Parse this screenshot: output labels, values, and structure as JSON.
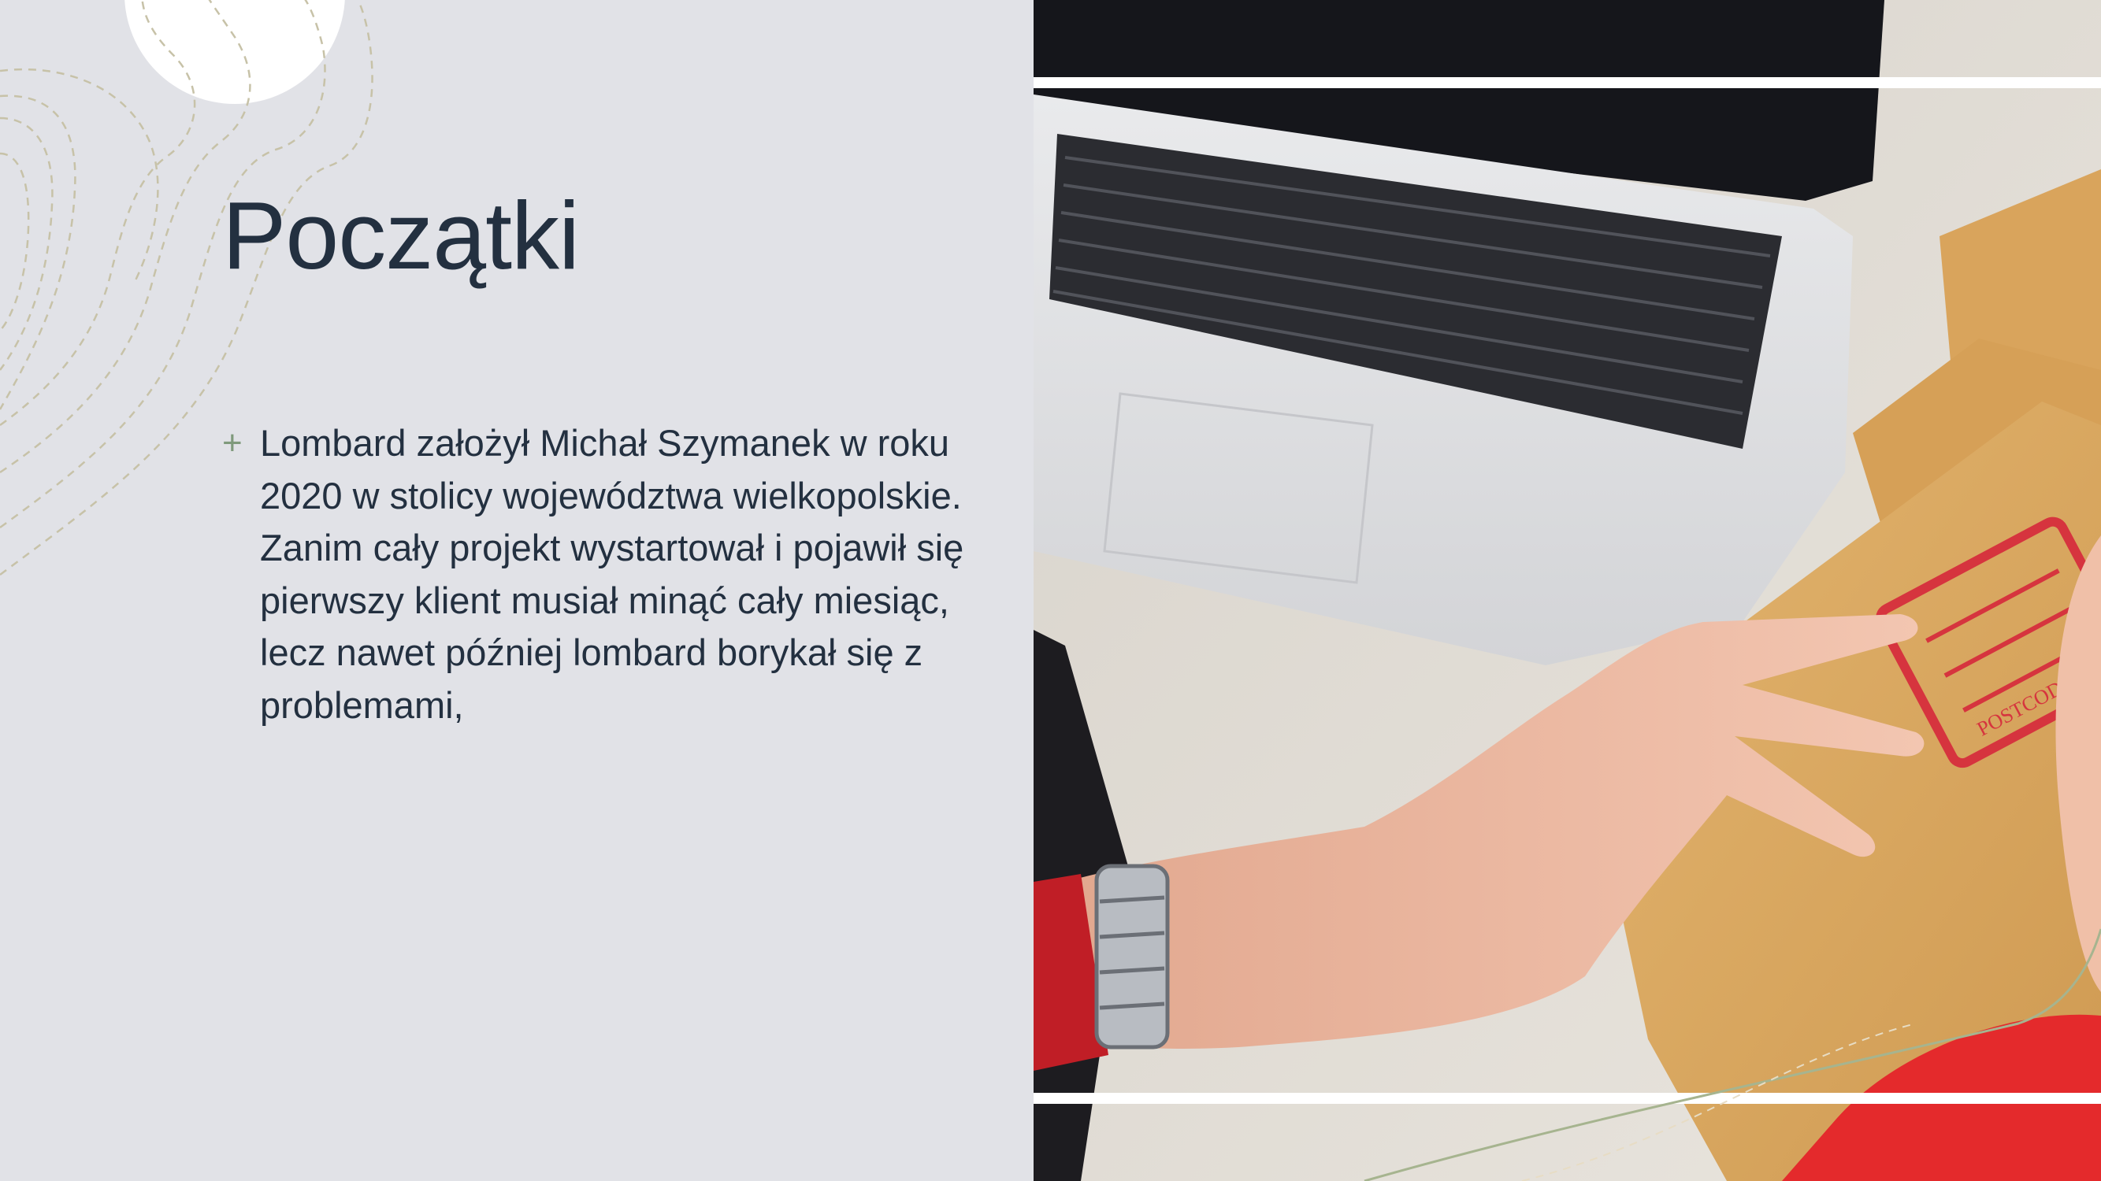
{
  "slide": {
    "title": "Początki",
    "bullets": [
      {
        "marker": "+",
        "text": "Lombard założył Michał Szymanek w roku 2020 w stolicy województwa wielkopolskie. Zanim cały projekt wystartował i pojawił się pierwszy klient musiał minąć cały miesiąc, lecz nawet później lombard borykał się z problemami,"
      }
    ]
  },
  "photo": {
    "box_label": "POSTCODE"
  },
  "colors": {
    "background": "#e1e2e7",
    "title": "#233040",
    "accent": "#7f9a7c",
    "deco_line": "#c7c2a8"
  }
}
